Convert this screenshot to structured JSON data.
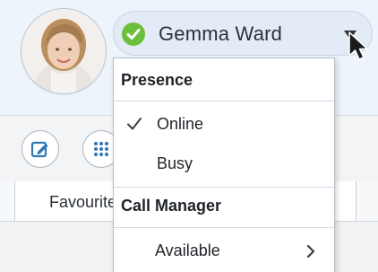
{
  "user": {
    "name": "Gemma Ward",
    "status": "online",
    "status_color": "#6cbf3b"
  },
  "menu": {
    "presence_heading": "Presence",
    "presence_options": [
      {
        "label": "Online",
        "selected": true
      },
      {
        "label": "Busy",
        "selected": false
      }
    ],
    "call_manager_heading": "Call Manager",
    "call_manager_options": [
      {
        "label": "Available",
        "has_submenu": true
      }
    ]
  },
  "toolbar": {
    "buttons": [
      {
        "name": "compose",
        "icon": "compose-icon"
      },
      {
        "name": "dialpad",
        "icon": "dialpad-icon"
      }
    ]
  },
  "tabs": {
    "favourites_label": "Favourites"
  },
  "colors": {
    "accent": "#2f78b7",
    "online_green": "#6cbf3b"
  }
}
